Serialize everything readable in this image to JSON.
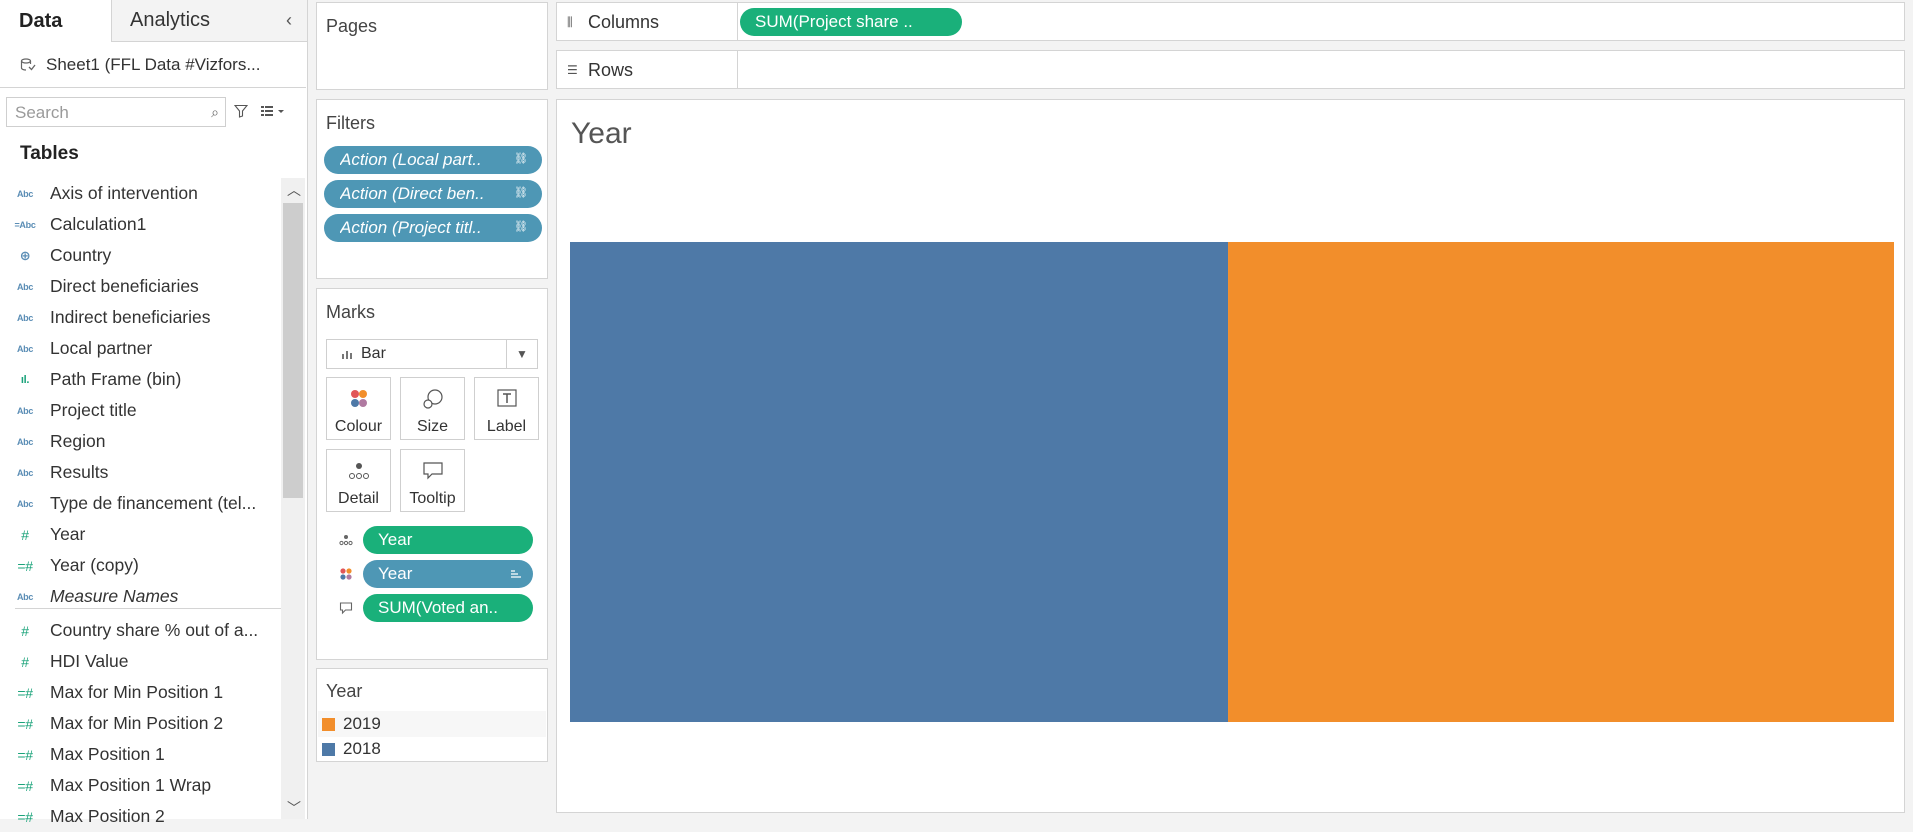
{
  "data_pane": {
    "tab_data": "Data",
    "tab_analytics": "Analytics",
    "datasource": "Sheet1 (FFL Data #Vizfors...",
    "search_placeholder": "Search",
    "tables_heading": "Tables",
    "fields": [
      {
        "label": "Axis of intervention",
        "type": "Abc"
      },
      {
        "label": "Calculation1",
        "type": "=Abc"
      },
      {
        "label": "Country",
        "type": "geo"
      },
      {
        "label": "Direct beneficiaries",
        "type": "Abc"
      },
      {
        "label": "Indirect beneficiaries",
        "type": "Abc"
      },
      {
        "label": "Local partner",
        "type": "Abc"
      },
      {
        "label": "Path Frame (bin)",
        "type": "bin"
      },
      {
        "label": "Project title",
        "type": "Abc"
      },
      {
        "label": "Region",
        "type": "Abc"
      },
      {
        "label": "Results",
        "type": "Abc"
      },
      {
        "label": "Type de financement (tel...",
        "type": "Abc"
      },
      {
        "label": "Year",
        "type": "#"
      },
      {
        "label": "Year (copy)",
        "type": "=#"
      },
      {
        "label": "Measure Names",
        "type": "Abc"
      },
      {
        "label": "Country share % out of a...",
        "type": "#"
      },
      {
        "label": "HDI Value",
        "type": "#"
      },
      {
        "label": "Max for Min Position 1",
        "type": "=#"
      },
      {
        "label": "Max for Min Position 2",
        "type": "=#"
      },
      {
        "label": "Max Position 1",
        "type": "=#"
      },
      {
        "label": "Max Position 1 Wrap",
        "type": "=#"
      },
      {
        "label": "Max Position 2",
        "type": "=#"
      }
    ]
  },
  "pages": {
    "title": "Pages"
  },
  "filters": {
    "title": "Filters",
    "items": [
      "Action (Local part..",
      "Action (Direct ben..",
      "Action (Project titl.."
    ]
  },
  "marks": {
    "title": "Marks",
    "mark_type": "Bar",
    "buttons": {
      "colour": "Colour",
      "size": "Size",
      "label": "Label",
      "detail": "Detail",
      "tooltip": "Tooltip"
    },
    "shelf": [
      {
        "label": "Year",
        "kind": "detail",
        "color": "green"
      },
      {
        "label": "Year",
        "kind": "colour",
        "color": "blue"
      },
      {
        "label": "SUM(Voted an..",
        "kind": "tooltip",
        "color": "green"
      }
    ]
  },
  "legend": {
    "title": "Year",
    "items": [
      {
        "label": "2019",
        "color": "#f28e2b"
      },
      {
        "label": "2018",
        "color": "#4e79a7"
      }
    ]
  },
  "shelves": {
    "columns_label": "Columns",
    "columns_pill": "SUM(Project share ..",
    "rows_label": "Rows"
  },
  "view": {
    "title": "Year"
  },
  "chart_data": {
    "type": "bar",
    "orientation": "horizontal",
    "stacked": true,
    "measure": "SUM(Project share ..",
    "series": [
      {
        "name": "2018",
        "value": 0.497,
        "color": "#4e79a7"
      },
      {
        "name": "2019",
        "value": 0.503,
        "color": "#f28e2b"
      }
    ],
    "grid": false
  }
}
